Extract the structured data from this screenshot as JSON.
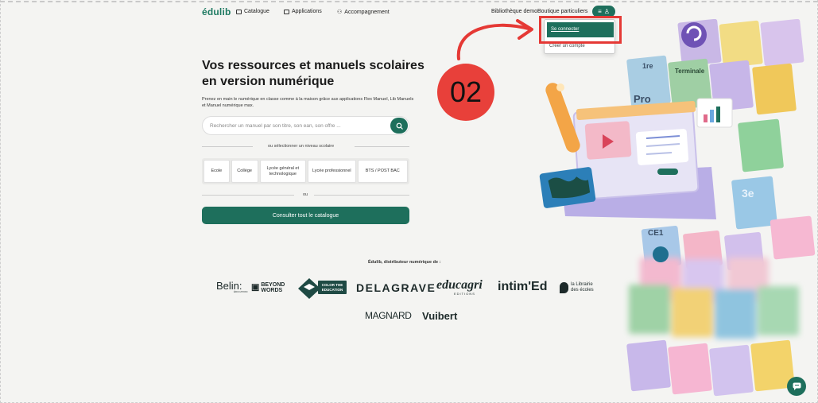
{
  "nav": {
    "logo": "édulib",
    "links": [
      "Catalogue",
      "Applications",
      "Accompagnement"
    ],
    "demo_library": "Bibliothèque demo",
    "shop": "Boutique particuliers"
  },
  "dropdown": {
    "login": "Se connecter",
    "create_account": "Créer un compte"
  },
  "annotation": {
    "step": "02",
    "accent_color": "#e53935"
  },
  "hero": {
    "title": "Vos ressources et manuels scolaires en version numérique",
    "description": "Prenez en main le numérique en classe comme à la maison grâce aux applications Flex Manuel, Lib Manuels et Manuel numérique max."
  },
  "search": {
    "placeholder": "Rechercher un manuel par son titre, son ean, son offre ..."
  },
  "level_select": {
    "label": "ou sélectionner un niveau scolaire",
    "levels": [
      "Ecole",
      "Collège",
      "Lycée général et technologique",
      "Lycée professionnel",
      "BTS / POST BAC"
    ]
  },
  "or_label": "ou",
  "catalog_button": "Consulter tout le catalogue",
  "partners": {
    "title": "Édulib, distributeur numérique de :",
    "brands": [
      "Belin",
      "ÉDUCATION",
      "BEYOND",
      "WORDS",
      "COLOR THE",
      "EDUCATION",
      "DELAGRAVE",
      "educagri",
      "EDITIONS",
      "intim'Ed",
      "la Librairie",
      "des écoles",
      "MAGNARD",
      "Vuibert"
    ]
  },
  "illustration": {
    "cards": [
      "1re",
      "Pro",
      "Terminale",
      "3e",
      "CE1"
    ]
  },
  "colors": {
    "brand": "#1e6f5c",
    "accent": "#e53935"
  }
}
